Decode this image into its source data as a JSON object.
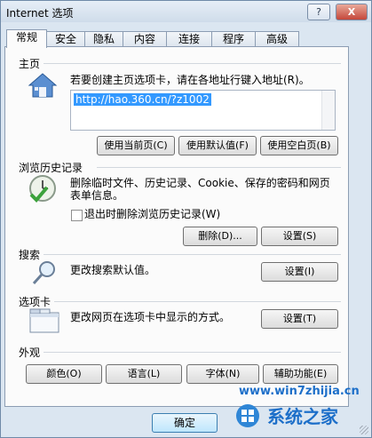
{
  "window": {
    "title": "Internet 选项",
    "help_label": "?",
    "close_label": "X"
  },
  "tabs": [
    {
      "label": "常规"
    },
    {
      "label": "安全"
    },
    {
      "label": "隐私"
    },
    {
      "label": "内容"
    },
    {
      "label": "连接"
    },
    {
      "label": "程序"
    },
    {
      "label": "高级"
    }
  ],
  "home": {
    "section_label": "主页",
    "description": "若要创建主页选项卡，请在各地址行键入地址(R)。",
    "url_value": "http://hao.360.cn/?z1002",
    "use_current_label": "使用当前页(C)",
    "use_default_label": "使用默认值(F)",
    "use_blank_label": "使用空白页(B)"
  },
  "history": {
    "section_label": "浏览历史记录",
    "description_line1": "删除临时文件、历史记录、Cookie、保存的密码和网页",
    "description_line2": "表单信息。",
    "checkbox_label": "退出时删除浏览历史记录(W)",
    "delete_label": "删除(D)...",
    "settings_label": "设置(S)"
  },
  "search": {
    "section_label": "搜索",
    "description": "更改搜索默认值。",
    "settings_label": "设置(I)"
  },
  "tabsection": {
    "section_label": "选项卡",
    "description": "更改网页在选项卡中显示的方式。",
    "settings_label": "设置(T)"
  },
  "appearance": {
    "section_label": "外观",
    "colors_label": "颜色(O)",
    "languages_label": "语言(L)",
    "fonts_label": "字体(N)",
    "accessibility_label": "辅助功能(E)"
  },
  "footer": {
    "ok_label": "确定"
  },
  "watermark": {
    "brand_text": "系统之家",
    "site_text": "www.win7zhijia.cn"
  },
  "colors": {
    "window_bg": "#dbe6f1",
    "selection": "#3399ff",
    "watermark_blue": "#1d6fc9"
  }
}
